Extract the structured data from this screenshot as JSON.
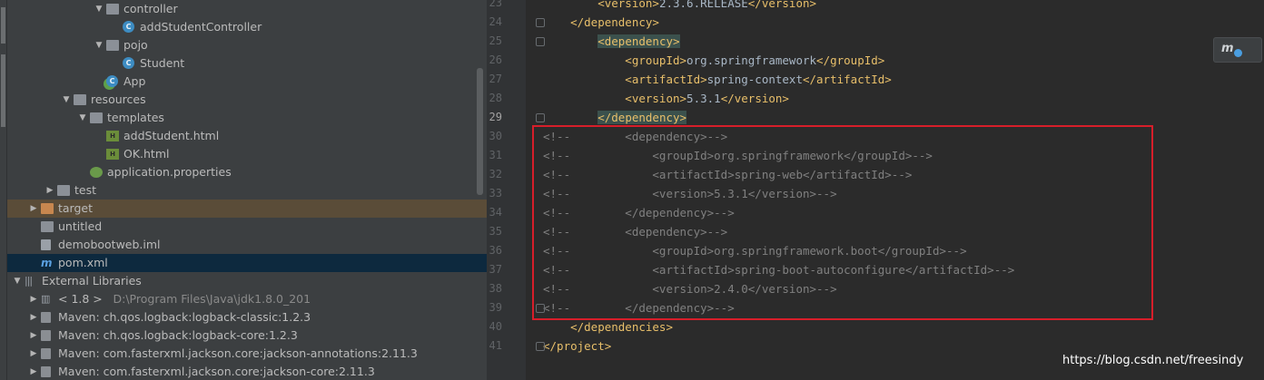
{
  "project_tree": {
    "rows": [
      {
        "arrow": "▼",
        "icon": "folder-icon",
        "label": "controller"
      },
      {
        "arrow": "",
        "icon": "class-icon",
        "label": "addStudentController"
      },
      {
        "arrow": "▼",
        "icon": "folder-icon",
        "label": "pojo"
      },
      {
        "arrow": "",
        "icon": "class-icon",
        "label": "Student"
      },
      {
        "arrow": "",
        "icon": "spring-boot-class-icon",
        "label": "App"
      },
      {
        "arrow": "▼",
        "icon": "resources-folder-icon",
        "label": "resources"
      },
      {
        "arrow": "▼",
        "icon": "folder-icon",
        "label": "templates"
      },
      {
        "arrow": "",
        "icon": "html-file-icon",
        "label": "addStudent.html"
      },
      {
        "arrow": "",
        "icon": "html-file-icon",
        "label": "OK.html"
      },
      {
        "arrow": "",
        "icon": "properties-file-icon",
        "label": "application.properties"
      },
      {
        "arrow": "▶",
        "icon": "folder-icon",
        "label": "test"
      },
      {
        "arrow": "▶",
        "icon": "excluded-folder-icon",
        "label": "target"
      },
      {
        "arrow": "",
        "icon": "folder-icon",
        "label": "untitled"
      },
      {
        "arrow": "",
        "icon": "module-file-icon",
        "label": "demobootweb.iml"
      },
      {
        "arrow": "",
        "icon": "maven-file-icon",
        "label": "pom.xml"
      },
      {
        "arrow": "▼",
        "icon": "libraries-icon",
        "label": "External Libraries"
      },
      {
        "arrow": "▶",
        "icon": "jdk-icon",
        "label": "< 1.8 >",
        "sub": "D:\\Program Files\\Java\\jdk1.8.0_201"
      },
      {
        "arrow": "▶",
        "icon": "jar-icon",
        "label": "Maven: ch.qos.logback:logback-classic:1.2.3"
      },
      {
        "arrow": "▶",
        "icon": "jar-icon",
        "label": "Maven: ch.qos.logback:logback-core:1.2.3"
      },
      {
        "arrow": "▶",
        "icon": "jar-icon",
        "label": "Maven: com.fasterxml.jackson.core:jackson-annotations:2.11.3"
      },
      {
        "arrow": "▶",
        "icon": "jar-icon",
        "label": "Maven: com.fasterxml.jackson.core:jackson-core:2.11.3"
      }
    ]
  },
  "editor": {
    "lines": [
      {
        "n": "23",
        "segs": [
          {
            "c": "t",
            "s": "        <version>"
          },
          {
            "c": "tx",
            "s": "2.3.6.RELEASE"
          },
          {
            "c": "t",
            "s": "</version>"
          }
        ]
      },
      {
        "n": "24",
        "segs": [
          {
            "c": "t",
            "s": "    </dependency>"
          }
        ]
      },
      {
        "n": "25",
        "segs": [
          {
            "c": "tx",
            "s": "        "
          },
          {
            "c": "t hl",
            "s": "<dependency>"
          }
        ]
      },
      {
        "n": "26",
        "segs": [
          {
            "c": "t",
            "s": "            <groupId>"
          },
          {
            "c": "tx",
            "s": "org.springframework"
          },
          {
            "c": "t",
            "s": "</groupId>"
          }
        ]
      },
      {
        "n": "27",
        "segs": [
          {
            "c": "t",
            "s": "            <artifactId>"
          },
          {
            "c": "tx",
            "s": "spring-context"
          },
          {
            "c": "t",
            "s": "</artifactId>"
          }
        ]
      },
      {
        "n": "28",
        "segs": [
          {
            "c": "t",
            "s": "            <version>"
          },
          {
            "c": "tx",
            "s": "5.3.1"
          },
          {
            "c": "t",
            "s": "</version>"
          }
        ]
      },
      {
        "n": "29",
        "segs": [
          {
            "c": "tx",
            "s": "        "
          },
          {
            "c": "t hl",
            "s": "</dependency>"
          }
        ]
      },
      {
        "n": "30",
        "segs": [
          {
            "c": "cm",
            "s": "<!--        <dependency>-->"
          }
        ]
      },
      {
        "n": "31",
        "segs": [
          {
            "c": "cm",
            "s": "<!--            <groupId>org.springframework</groupId>-->"
          }
        ]
      },
      {
        "n": "32",
        "segs": [
          {
            "c": "cm",
            "s": "<!--            <artifactId>spring-web</artifactId>-->"
          }
        ]
      },
      {
        "n": "33",
        "segs": [
          {
            "c": "cm",
            "s": "<!--            <version>5.3.1</version>-->"
          }
        ]
      },
      {
        "n": "34",
        "segs": [
          {
            "c": "cm",
            "s": "<!--        </dependency>-->"
          }
        ]
      },
      {
        "n": "35",
        "segs": [
          {
            "c": "cm",
            "s": "<!--        <dependency>-->"
          }
        ]
      },
      {
        "n": "36",
        "segs": [
          {
            "c": "cm",
            "s": "<!--            <groupId>org.springframework.boot</groupId>-->"
          }
        ]
      },
      {
        "n": "37",
        "segs": [
          {
            "c": "cm",
            "s": "<!--            <artifactId>spring-boot-autoconfigure</artifactId>-->"
          }
        ]
      },
      {
        "n": "38",
        "segs": [
          {
            "c": "cm",
            "s": "<!--            <version>2.4.0</version>-->"
          }
        ]
      },
      {
        "n": "39",
        "segs": [
          {
            "c": "cm",
            "s": "<!--        </dependency>-->"
          }
        ]
      },
      {
        "n": "40",
        "segs": [
          {
            "c": "t",
            "s": "    </dependencies>"
          }
        ]
      },
      {
        "n": "41",
        "segs": [
          {
            "c": "t",
            "s": "</project>"
          }
        ]
      }
    ],
    "current_line": "29"
  },
  "maven_badge": {
    "label": "m"
  },
  "watermark": "https://blog.csdn.net/freesindy",
  "colors": {
    "tag": "#e8bf6a",
    "text": "#a9b7c6",
    "comment": "#808080",
    "annotation_box": "#d71e2a",
    "selected_row": "#0d293e",
    "target_row": "#5a4c38"
  }
}
